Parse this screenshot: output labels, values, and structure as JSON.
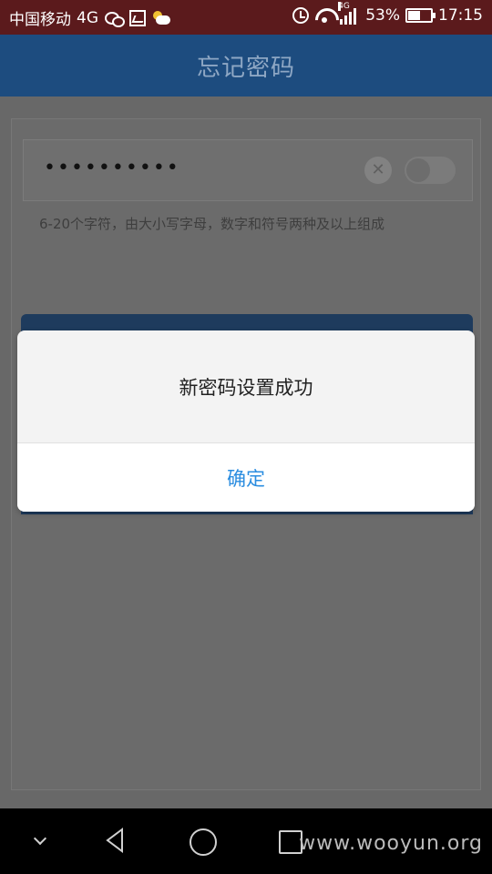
{
  "status_bar": {
    "carrier": "中国移动",
    "network": "4G",
    "signal_network": "4G",
    "battery": "53%",
    "battery_level": 0.53,
    "time": "17:15",
    "icons": [
      "wechat-icon",
      "image-icon",
      "weather-icon",
      "alarm-icon",
      "wifi-icon",
      "signal-icon",
      "battery-icon"
    ]
  },
  "header": {
    "title": "忘记密码"
  },
  "form": {
    "password_value": "••••••••••",
    "toggle_on": false,
    "hint": "6-20个字符，由大小写字母，数字和符号两种及以上组成"
  },
  "dialog": {
    "message": "新密码设置成功",
    "ok_label": "确定"
  },
  "watermark": "www.wooyun.org",
  "colors": {
    "header": "#1d4c7f",
    "status_bar": "#5b1a1c",
    "dialog_button": "#2b8de0"
  }
}
